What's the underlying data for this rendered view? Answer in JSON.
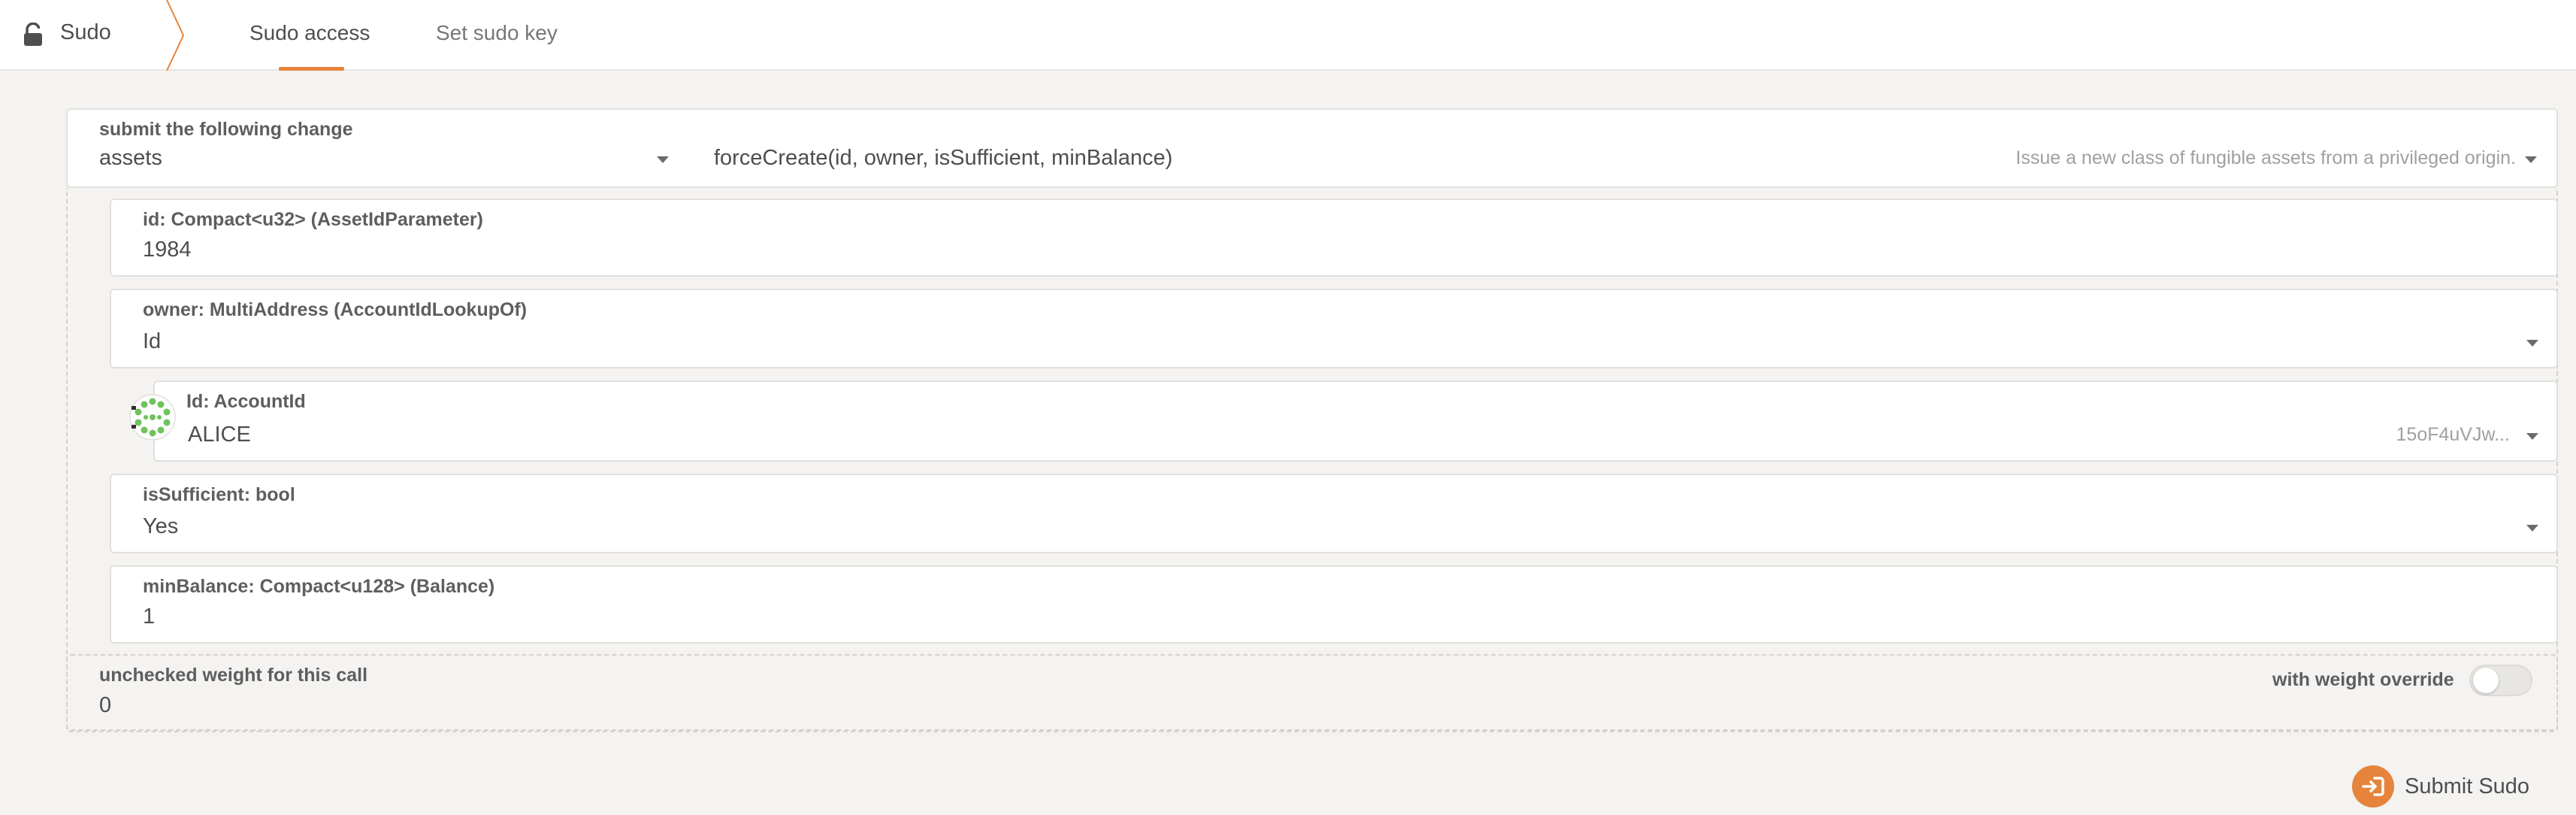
{
  "nav": {
    "brand_label": "Sudo",
    "tabs": [
      {
        "label": "Sudo access",
        "active": true
      },
      {
        "label": "Set sudo key",
        "active": false
      }
    ]
  },
  "call": {
    "section_label": "submit the following change",
    "pallet": "assets",
    "method": "forceCreate(id, owner, isSufficient, minBalance)",
    "method_doc": "Issue a new class of fungible assets from a privileged origin."
  },
  "params": {
    "id": {
      "label": "id: Compact<u32> (AssetIdParameter)",
      "value": "1984"
    },
    "owner": {
      "label": "owner: MultiAddress (AccountIdLookupOf)",
      "value": "Id"
    },
    "account": {
      "label": "Id: AccountId",
      "value": "ALICE",
      "address_short": "15oF4uVJw..."
    },
    "isSufficient": {
      "label": "isSufficient: bool",
      "value": "Yes"
    },
    "minBalance": {
      "label": "minBalance: Compact<u128> (Balance)",
      "value": "1"
    }
  },
  "weight": {
    "label": "unchecked weight for this call",
    "value": "0",
    "override_label": "with weight override",
    "override_enabled": false
  },
  "actions": {
    "submit_label": "Submit Sudo"
  },
  "colors": {
    "accent": "#e6843b",
    "identicon_green": "#6fc35b"
  }
}
